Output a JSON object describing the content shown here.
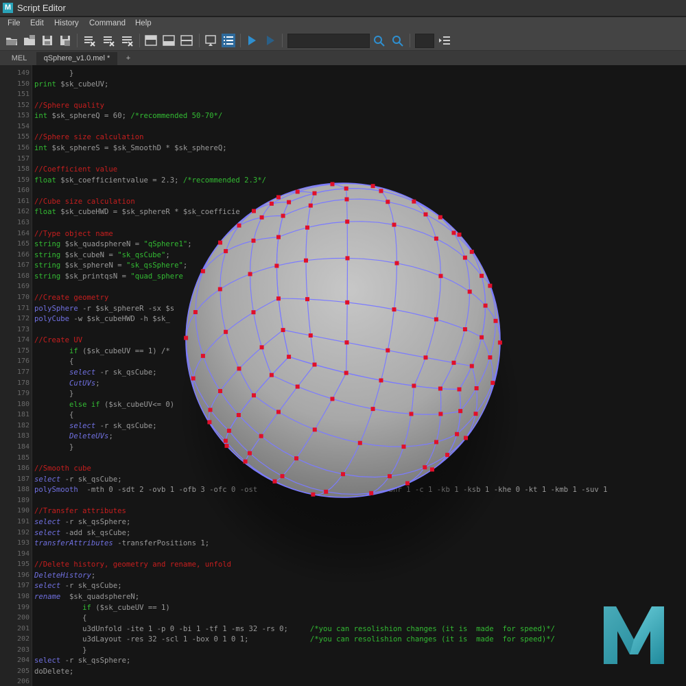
{
  "window": {
    "title": "Script Editor",
    "app_icon": "maya-icon"
  },
  "menu": [
    "File",
    "Edit",
    "History",
    "Command",
    "Help"
  ],
  "tabs": [
    "MEL",
    "qSphere_v1.0.mel *",
    "+"
  ],
  "editor": {
    "lines": [
      {
        "n": "149",
        "t": [
          [
            "",
            "        }"
          ]
        ]
      },
      {
        "n": "150",
        "t": [
          [
            "kw",
            "print"
          ],
          [
            "",
            " $sk_cubeUV;"
          ]
        ]
      },
      {
        "n": "151",
        "t": []
      },
      {
        "n": "152",
        "t": [
          [
            "cm",
            "//Sphere quality"
          ]
        ]
      },
      {
        "n": "153",
        "t": [
          [
            "kw",
            "int"
          ],
          [
            "",
            " $sk_sphereQ = 60; "
          ],
          [
            "kw",
            "/*recommended 50-70*/"
          ]
        ]
      },
      {
        "n": "154",
        "t": []
      },
      {
        "n": "155",
        "t": [
          [
            "cm",
            "//Sphere size calculation"
          ]
        ]
      },
      {
        "n": "156",
        "t": [
          [
            "kw",
            "int"
          ],
          [
            "",
            " $sk_sphereS = $sk_SmoothD * $sk_sphereQ;"
          ]
        ]
      },
      {
        "n": "157",
        "t": []
      },
      {
        "n": "158",
        "t": [
          [
            "cm",
            "//Coefficient value"
          ]
        ]
      },
      {
        "n": "159",
        "t": [
          [
            "kw",
            "float"
          ],
          [
            "",
            " $sk_coefficientvalue = 2.3; "
          ],
          [
            "kw",
            "/*recommended 2.3*/"
          ]
        ]
      },
      {
        "n": "160",
        "t": []
      },
      {
        "n": "161",
        "t": [
          [
            "cm",
            "//Cube size calculation"
          ]
        ]
      },
      {
        "n": "162",
        "t": [
          [
            "kw",
            "float"
          ],
          [
            "",
            " $sk_cubeHWD = $sk_sphereR * $sk_coefficie"
          ]
        ]
      },
      {
        "n": "163",
        "t": []
      },
      {
        "n": "164",
        "t": [
          [
            "cm",
            "//Type object name"
          ]
        ]
      },
      {
        "n": "165",
        "t": [
          [
            "kw",
            "string"
          ],
          [
            "",
            " $sk_quadsphereN = "
          ],
          [
            "kw",
            "\"qSphere1\""
          ],
          [
            "",
            ";"
          ]
        ]
      },
      {
        "n": "166",
        "t": [
          [
            "kw",
            "string"
          ],
          [
            "",
            " $sk_cubeN = "
          ],
          [
            "kw",
            "\"sk_qsCube\""
          ],
          [
            "",
            ";"
          ]
        ]
      },
      {
        "n": "167",
        "t": [
          [
            "kw",
            "string"
          ],
          [
            "",
            " $sk_sphereN = "
          ],
          [
            "kw",
            "\"sk_qsSphere\""
          ],
          [
            "",
            ";"
          ]
        ]
      },
      {
        "n": "168",
        "t": [
          [
            "kw",
            "string"
          ],
          [
            "",
            " $sk_printqsN = "
          ],
          [
            "kw",
            "\"quad_sphere"
          ]
        ]
      },
      {
        "n": "169",
        "t": []
      },
      {
        "n": "170",
        "t": [
          [
            "cm",
            "//Create geometry"
          ]
        ]
      },
      {
        "n": "171",
        "t": [
          [
            "fn2",
            "polySphere"
          ],
          [
            "",
            " -r $sk_sphereR -sx $s"
          ]
        ]
      },
      {
        "n": "172",
        "t": [
          [
            "fn2",
            "polyCube"
          ],
          [
            "",
            " -w $sk_cubeHWD -h $sk_"
          ]
        ]
      },
      {
        "n": "173",
        "t": []
      },
      {
        "n": "174",
        "t": [
          [
            "cm",
            "//Create UV"
          ]
        ]
      },
      {
        "n": "175",
        "t": [
          [
            "kw",
            "        if"
          ],
          [
            "",
            " ($sk_cubeUV == 1) /*"
          ]
        ]
      },
      {
        "n": "176",
        "t": [
          [
            "",
            "        {"
          ]
        ]
      },
      {
        "n": "177",
        "t": [
          [
            "fn",
            "        select"
          ],
          [
            "",
            " -r sk_qsCube;"
          ]
        ]
      },
      {
        "n": "178",
        "t": [
          [
            "fn",
            "        CutUVs"
          ],
          [
            "",
            ";"
          ]
        ]
      },
      {
        "n": "179",
        "t": [
          [
            "",
            "        }"
          ]
        ]
      },
      {
        "n": "180",
        "t": [
          [
            "kw",
            "        else if"
          ],
          [
            "",
            " ($sk_cubeUV<= 0)"
          ]
        ]
      },
      {
        "n": "181",
        "t": [
          [
            "",
            "        {"
          ]
        ]
      },
      {
        "n": "182",
        "t": [
          [
            "fn",
            "        select"
          ],
          [
            "",
            " -r sk_qsCube;"
          ]
        ]
      },
      {
        "n": "183",
        "t": [
          [
            "fn",
            "        DeleteUVs"
          ],
          [
            "",
            ";"
          ]
        ]
      },
      {
        "n": "184",
        "t": [
          [
            "",
            "        }"
          ]
        ]
      },
      {
        "n": "185",
        "t": []
      },
      {
        "n": "186",
        "t": [
          [
            "cm",
            "//Smooth cube"
          ]
        ]
      },
      {
        "n": "187",
        "t": [
          [
            "fn",
            "select"
          ],
          [
            "",
            " -r sk_qsCube;"
          ]
        ]
      },
      {
        "n": "188",
        "t": [
          [
            "fn2",
            "polySmooth"
          ],
          [
            "",
            "  -mth 0 -sdt 2 -ovb 1 -ofb 3 -ofc 0 -ost"
          ],
          [
            "",
            "                        sh 0 -bnr 1 -c 1 -kb 1 -ksb 1 -khe 0 -kt 1 -kmb 1 -suv 1"
          ]
        ]
      },
      {
        "n": "189",
        "t": []
      },
      {
        "n": "190",
        "t": [
          [
            "cm",
            "//Transfer attributes"
          ]
        ]
      },
      {
        "n": "191",
        "t": [
          [
            "fn",
            "select"
          ],
          [
            "",
            " -r sk_qsSphere;"
          ]
        ]
      },
      {
        "n": "192",
        "t": [
          [
            "fn",
            "select"
          ],
          [
            "",
            " -add sk_qsCube;"
          ]
        ]
      },
      {
        "n": "193",
        "t": [
          [
            "fn",
            "transferAttributes"
          ],
          [
            "",
            " -transferPositions 1;"
          ]
        ]
      },
      {
        "n": "194",
        "t": []
      },
      {
        "n": "195",
        "t": [
          [
            "cm",
            "//Delete history, geometry and rename, unfold"
          ]
        ]
      },
      {
        "n": "196",
        "t": [
          [
            "fn",
            "DeleteHistory"
          ],
          [
            "",
            ";"
          ]
        ]
      },
      {
        "n": "197",
        "t": [
          [
            "fn",
            "select"
          ],
          [
            "",
            " -r sk_qsCube;"
          ]
        ]
      },
      {
        "n": "198",
        "t": [
          [
            "fn",
            "rename"
          ],
          [
            "",
            "  $sk_quadsphereN;"
          ]
        ]
      },
      {
        "n": "199",
        "t": [
          [
            "kw",
            "           if"
          ],
          [
            "",
            " ($sk_cubeUV == 1)"
          ]
        ]
      },
      {
        "n": "200",
        "t": [
          [
            "",
            "           {"
          ]
        ]
      },
      {
        "n": "201",
        "t": [
          [
            "",
            "           u3dUnfold -ite 1 -p 0 -bi 1 -tf 1 -ms 32 -rs 0;     "
          ],
          [
            "kw",
            "/*you can resolishion changes (it is  made  for speed)*/"
          ]
        ]
      },
      {
        "n": "202",
        "t": [
          [
            "",
            "           u3dLayout -res 32 -scl 1 -box 0 1 0 1;              "
          ],
          [
            "kw",
            "/*you can resolishion changes (it is  made  for speed)*/"
          ]
        ]
      },
      {
        "n": "203",
        "t": [
          [
            "",
            "           }"
          ]
        ]
      },
      {
        "n": "204",
        "t": [
          [
            "fn2",
            "select"
          ],
          [
            "",
            " -r sk_qsSphere;"
          ]
        ]
      },
      {
        "n": "205",
        "t": [
          [
            "",
            "doDelete;"
          ]
        ]
      },
      {
        "n": "206",
        "t": []
      }
    ]
  },
  "colors": {
    "keyword": "#33bb33",
    "comment": "#c81e1e",
    "function": "#7070e0",
    "vertex": "#e0102a",
    "wire": "#7b7bff",
    "logo": "#3fb8c8"
  }
}
